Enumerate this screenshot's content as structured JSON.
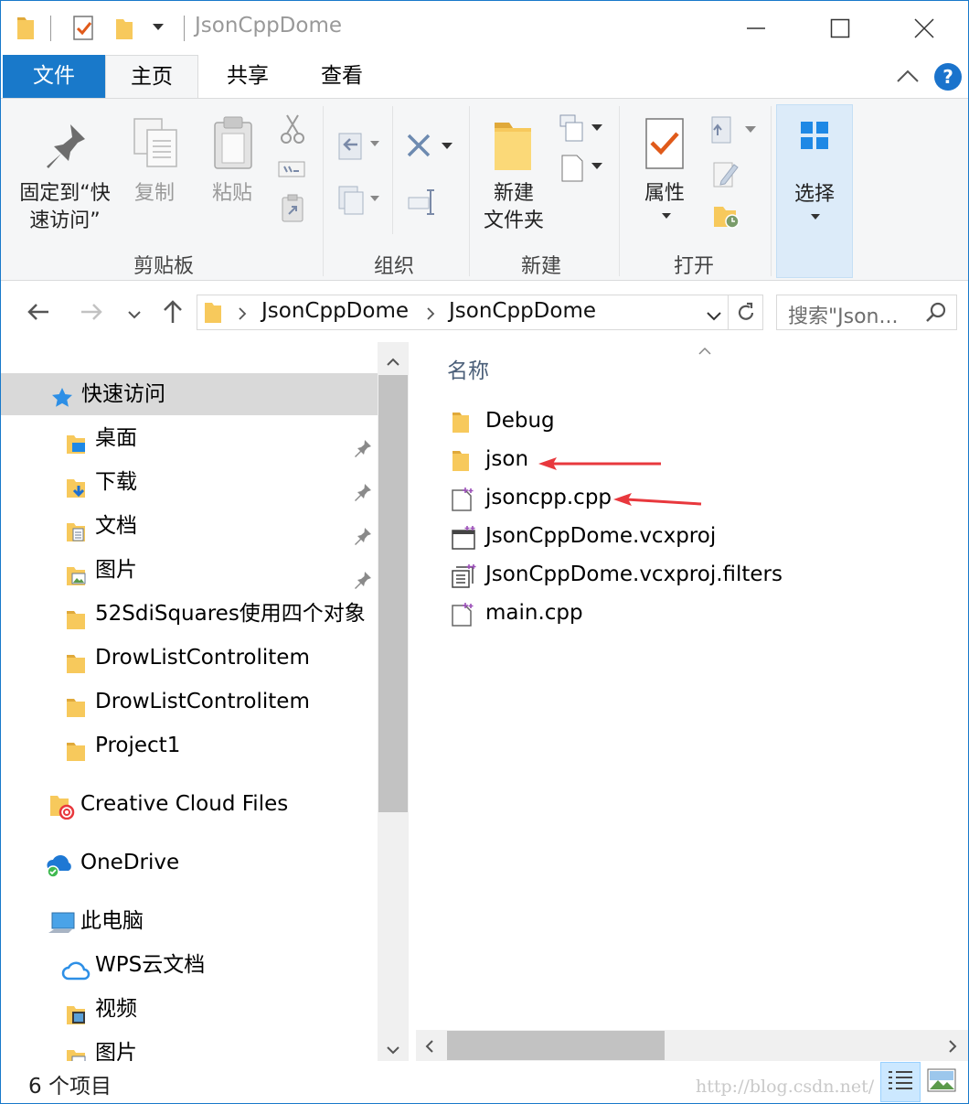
{
  "window": {
    "title": "JsonCppDome",
    "controls": [
      "minimize",
      "maximize",
      "close"
    ]
  },
  "tabs": {
    "file": "文件",
    "home": "主页",
    "share": "共享",
    "view": "查看"
  },
  "ribbon": {
    "clipboard": {
      "label": "剪贴板",
      "pin_line1": "固定到“快",
      "pin_line2": "速访问”",
      "copy": "复制",
      "paste": "粘贴"
    },
    "organize": {
      "label": "组织"
    },
    "new": {
      "label": "新建",
      "new_folder_line1": "新建",
      "new_folder_line2": "文件夹"
    },
    "open": {
      "label": "打开",
      "properties": "属性"
    },
    "select": {
      "label": "选择"
    }
  },
  "address": {
    "segments": [
      "JsonCppDome",
      "JsonCppDome"
    ],
    "search_placeholder": "搜索\"Json..."
  },
  "nav": {
    "quick_access": "快速访问",
    "items": [
      {
        "label": "桌面",
        "icon": "desktop-folder-icon",
        "pinned": true
      },
      {
        "label": "下载",
        "icon": "downloads-folder-icon",
        "pinned": true
      },
      {
        "label": "文档",
        "icon": "documents-folder-icon",
        "pinned": true
      },
      {
        "label": "图片",
        "icon": "pictures-folder-icon",
        "pinned": true
      },
      {
        "label": "52SdiSquares使用四个对象",
        "icon": "folder-icon",
        "pinned": false
      },
      {
        "label": "DrowListControlitem",
        "icon": "folder-icon",
        "pinned": false
      },
      {
        "label": "DrowListControlitem",
        "icon": "folder-icon",
        "pinned": false
      },
      {
        "label": "Project1",
        "icon": "folder-icon",
        "pinned": false
      }
    ],
    "creative_cloud": "Creative Cloud Files",
    "onedrive": "OneDrive",
    "this_pc": "此电脑",
    "pc_items": [
      {
        "label": "WPS云文档",
        "icon": "wps-cloud-icon"
      },
      {
        "label": "视频",
        "icon": "videos-folder-icon"
      },
      {
        "label": "图片",
        "icon": "pictures-folder-icon"
      }
    ]
  },
  "files": {
    "column_name": "名称",
    "items": [
      {
        "name": "Debug",
        "icon": "folder-icon"
      },
      {
        "name": "json",
        "icon": "folder-icon"
      },
      {
        "name": "jsoncpp.cpp",
        "icon": "cpp-file-icon"
      },
      {
        "name": "JsonCppDome.vcxproj",
        "icon": "vcxproj-file-icon"
      },
      {
        "name": "JsonCppDome.vcxproj.filters",
        "icon": "filters-file-icon"
      },
      {
        "name": "main.cpp",
        "icon": "cpp-file-icon"
      }
    ]
  },
  "status": {
    "count": "6 个项目",
    "watermark": "http://blog.csdn.net/"
  },
  "colors": {
    "accent": "#1979ca",
    "folder": "#f7c95c",
    "annotation_arrow": "#e8383d"
  }
}
